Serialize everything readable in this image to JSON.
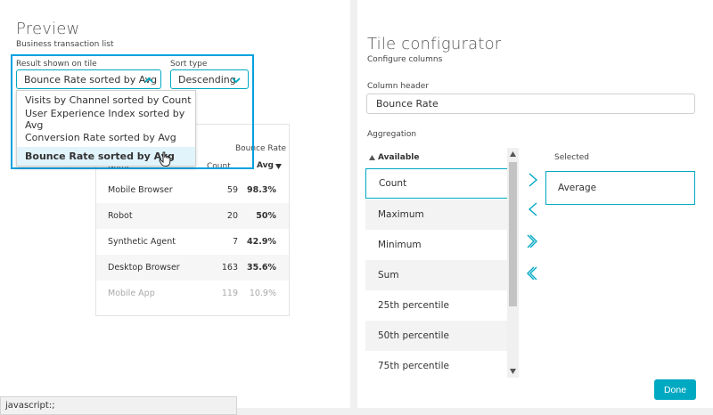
{
  "preview": {
    "title": "Preview",
    "subtitle": "Business transaction list",
    "result_label": "Result shown on tile",
    "result_value": "Bounce Rate sorted by Avg",
    "sort_label": "Sort type",
    "sort_value": "Descending",
    "result_options": [
      "Visits by Channel sorted by Count",
      "User Experience Index sorted by Avg",
      "Conversion Rate sorted by Avg",
      "Bounce Rate sorted by Avg"
    ],
    "table": {
      "group_header": "Bounce Rate",
      "col_name": "Name",
      "col_count": "Count",
      "col_avg": "Avg",
      "rows": [
        {
          "name": "Mobile Browser",
          "count": "59",
          "avg": "98.3%"
        },
        {
          "name": "Robot",
          "count": "20",
          "avg": "50%"
        },
        {
          "name": "Synthetic Agent",
          "count": "7",
          "avg": "42.9%"
        },
        {
          "name": "Desktop Browser",
          "count": "163",
          "avg": "35.6%"
        },
        {
          "name": "Mobile App",
          "count": "119",
          "avg": "10.9%"
        }
      ]
    }
  },
  "status_bar": "javascript:;",
  "config": {
    "title": "Tile configurator",
    "subtitle": "Configure columns",
    "column_header_label": "Column header",
    "column_header_value": "Bounce Rate",
    "aggregation_label": "Aggregation",
    "available_header": "Available",
    "available_items": [
      "Count",
      "Maximum",
      "Minimum",
      "Sum",
      "25th percentile",
      "50th percentile",
      "75th percentile"
    ],
    "selected_header": "Selected",
    "selected_items": [
      "Average"
    ],
    "done_label": "Done"
  },
  "colors": {
    "accent": "#00a9c2",
    "highlight": "#00a1e0",
    "menu_selected": "#e1f3fb"
  },
  "icons": [
    "chevron-up-icon",
    "chevron-down-icon",
    "hand-cursor-icon",
    "sort-down-icon",
    "sort-up-icon",
    "arrow-right-icon",
    "arrow-left-icon",
    "double-arrow-right-icon",
    "double-arrow-left-icon"
  ]
}
